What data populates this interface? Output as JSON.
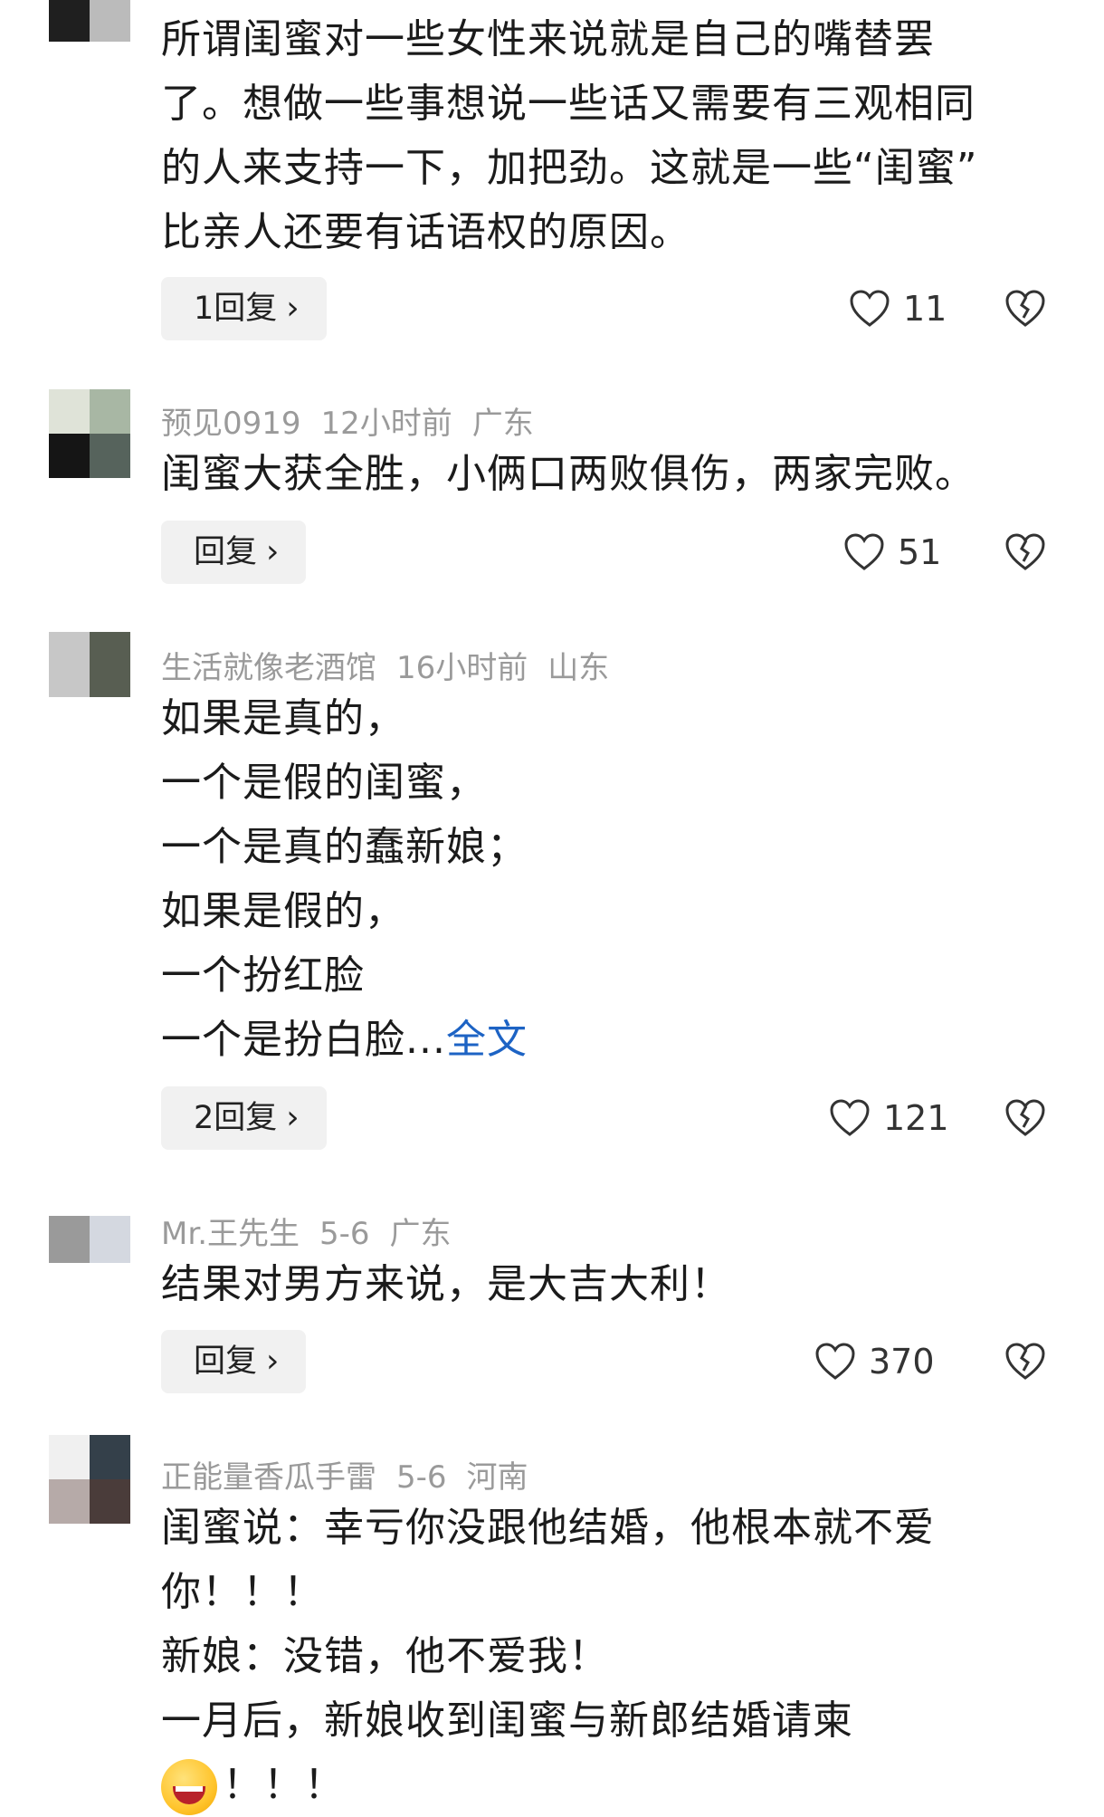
{
  "comments": [
    {
      "user": "",
      "time": "",
      "location": "",
      "lines": [
        "所谓闺蜜对一些女性来说就是自己的嘴替罢",
        "了。想做一些事想说一些话又需要有三观相同",
        "的人来支持一下，加把劲。这就是一些“闺蜜”",
        "比亲人还要有话语权的原因。"
      ],
      "reply_label": "1回复",
      "likes": "11",
      "avatar_colors": [
        "#2b2b2b",
        "#777777",
        "#1f1f1f",
        "#bbbbbb"
      ]
    },
    {
      "user": "预见0919",
      "time": "12小时前",
      "location": "广东",
      "lines": [
        "闺蜜大获全胜，小俩口两败俱伤，两家完败。"
      ],
      "reply_label": "回复",
      "likes": "51",
      "avatar_colors": [
        "#dfe3d8",
        "#a8b7a4",
        "#151515",
        "#56635c"
      ]
    },
    {
      "user": "生活就像老酒馆",
      "time": "16小时前",
      "location": "山东",
      "lines": [
        "如果是真的，",
        "一个是假的闺蜜，",
        "一个是真的蠢新娘；",
        "如果是假的，",
        "一个扮红脸",
        "一个是扮白脸..."
      ],
      "more_label": "全文",
      "reply_label": "2回复",
      "likes": "121",
      "avatar_colors": [
        "#c7c7c7",
        "#585e52",
        "#c7c7c7",
        "#585e52"
      ]
    },
    {
      "user": "Mr.王先生",
      "time": "5-6",
      "location": "广东",
      "lines": [
        "结果对男方来说，是大吉大利！"
      ],
      "reply_label": "回复",
      "likes": "370",
      "avatar_colors": [
        "#9a9a9a",
        "#d4d8e0",
        "#9a9a9a",
        "#d4d8e0"
      ]
    },
    {
      "user": "正能量香瓜手雷",
      "time": "5-6",
      "location": "河南",
      "lines": [
        "闺蜜说：幸亏你没跟他结婚，他根本就不爱",
        "你！！！",
        "新娘：没错，他不爱我！",
        "一月后，新娘收到闺蜜与新郎结婚请柬",
        "！！！"
      ],
      "emoji_icon": "grinning-squint-emoji",
      "reply_label": "",
      "likes": "",
      "avatar_colors": [
        "#f0f0f0",
        "#34404a",
        "#b6aaa8",
        "#4a3c3a"
      ]
    }
  ]
}
